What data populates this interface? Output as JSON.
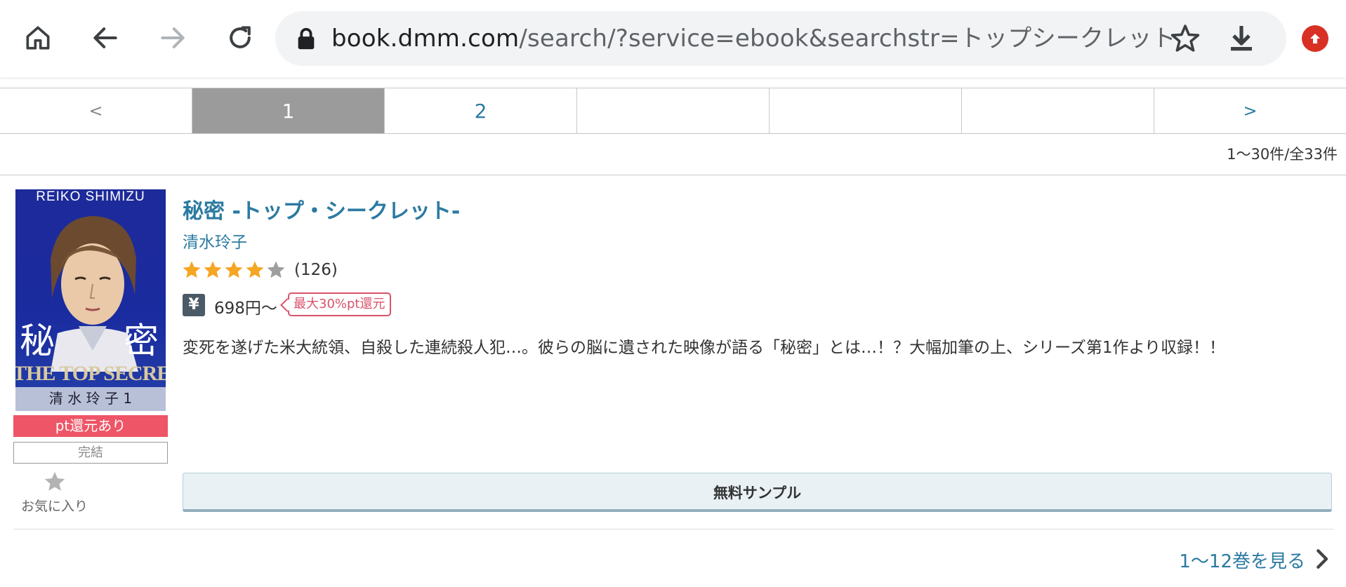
{
  "browser": {
    "url_host": "book.dmm.com",
    "url_rest": "/search/?service=ebook&searchstr=トップシークレット"
  },
  "pager": {
    "prev": "<",
    "pages": [
      "1",
      "2",
      "",
      "",
      ""
    ],
    "active": "1",
    "next": ">"
  },
  "result_count": "1〜30件/全33件",
  "item": {
    "cover": {
      "author_en": "REIKO SHIMIZU",
      "kanji_left": "秘",
      "kanji_right": "密",
      "title_en": "THE TOP SECRET",
      "volume": "清 水 玲 子  1"
    },
    "badge_pt": "pt還元あり",
    "badge_done": "完結",
    "favorite_label": "お気に入り",
    "title": "秘密 -トップ・シークレット-",
    "author": "清水玲子",
    "rating": 4,
    "rating_max": 5,
    "review_count": "(126)",
    "price": "698円〜",
    "pt_tag": "最大30%pt還元",
    "description": "変死を遂げた米大統領、自殺した連続殺人犯…。彼らの脳に遺された映像が語る「秘密」とは…！？大幅加筆の上、シリーズ第1作より収録！！",
    "sample_button": "無料サンプル",
    "see_volumes": "1〜12巻を見る"
  },
  "colors": {
    "link": "#2b7aa1",
    "star_on": "#f5a623",
    "star_off": "#9e9e9e",
    "pt_badge": "#ee5566",
    "active_page": "#9b9b9b"
  }
}
